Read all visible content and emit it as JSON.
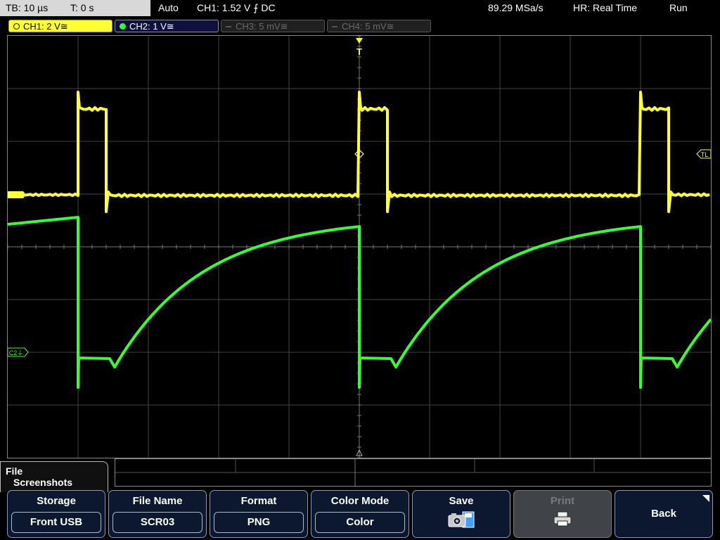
{
  "status": {
    "timebase": "TB: 10 µs",
    "time_pos": "T: 0 s",
    "trigger_mode": "Auto",
    "trigger_info": "CH1: 1.52 V ⨍ DC",
    "sample_rate": "89.29 MSa/s",
    "acq_mode": "HR: Real Time",
    "run_state": "Run"
  },
  "channels": [
    {
      "label": "CH1: 2 V≅",
      "color": "#ffff33",
      "state": "active"
    },
    {
      "label": "CH2: 1 V≅",
      "color": "#33ff33",
      "state": "on"
    },
    {
      "label": "CH3: 5 mV≅",
      "color": "#555555",
      "state": "off"
    },
    {
      "label": "CH4: 5 mV≅",
      "color": "#555555",
      "state": "off"
    }
  ],
  "markers": {
    "trigger": "T",
    "trigger_level": "TL",
    "ch2_ref": "C2⏚"
  },
  "menu": {
    "title_line1": "File",
    "title_line2": "Screenshots"
  },
  "softkeys": {
    "storage": {
      "title": "Storage",
      "value": "Front USB"
    },
    "file_name": {
      "title": "File Name",
      "value": "SCR03"
    },
    "format": {
      "title": "Format",
      "value": "PNG"
    },
    "color_mode": {
      "title": "Color Mode",
      "value": "Color"
    },
    "save": {
      "title": "Save",
      "icon": "camera-save-icon"
    },
    "print": {
      "title": "Print",
      "icon": "printer-icon"
    },
    "back": {
      "title": "Back"
    }
  },
  "colors": {
    "ch1": "#ffff33",
    "ch2": "#33ff33",
    "grid": "#444444",
    "softkey_bg": "#0c1830"
  }
}
